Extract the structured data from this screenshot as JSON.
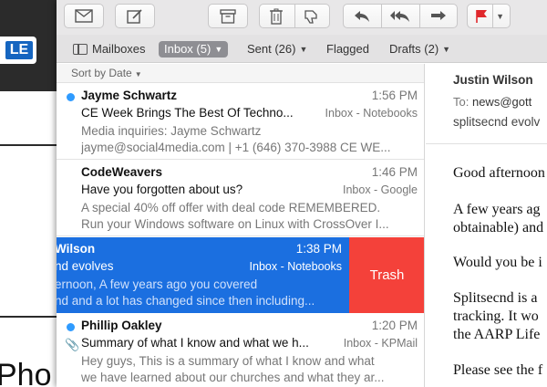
{
  "desktop": {
    "logo_text": "LE",
    "bottom_text": "Pho"
  },
  "toolbar": {
    "buttons": [
      {
        "icon": "envelope-icon"
      },
      {
        "icon": "compose-icon"
      },
      {
        "icon": "archive-icon"
      },
      {
        "icon": "trash-icon"
      },
      {
        "icon": "junk-icon"
      },
      {
        "icon": "reply-icon"
      },
      {
        "icon": "reply-all-icon"
      },
      {
        "icon": "forward-icon"
      },
      {
        "icon": "flag-icon"
      }
    ],
    "flag_color": "#e0282c"
  },
  "favorites": {
    "mailboxes": "Mailboxes",
    "inbox": "Inbox (5)",
    "sent": "Sent (26)",
    "flagged": "Flagged",
    "drafts": "Drafts (2)"
  },
  "list": {
    "sort_label": "Sort by Date",
    "messages": [
      {
        "from": "Jayme Schwartz",
        "time": "1:56 PM",
        "subject": "CE Week Brings The Best Of Techno...",
        "mailbox": "Inbox - Notebooks",
        "preview1": "Media inquiries: Jayme Schwartz",
        "preview2": "jayme@social4media.com | +1 (646) 370-3988 CE WE...",
        "unread": true
      },
      {
        "from": "CodeWeavers",
        "time": "1:46 PM",
        "subject": "Have you forgotten about us?",
        "mailbox": "Inbox - Google",
        "preview1": "A special 40% off offer with deal code REMEMBERED.",
        "preview2": "Run your Windows software on Linux with CrossOver I...",
        "unread": false
      },
      {
        "from": "Wilson",
        "time": "1:38 PM",
        "subject": "nd evolves",
        "mailbox": "Inbox - Notebooks",
        "preview1": "ernoon, A few years ago you covered",
        "preview2": "nd and a lot has changed since then including...",
        "swipe_action": "Trash"
      },
      {
        "from": "Phillip Oakley",
        "time": "1:20 PM",
        "subject": "Summary of what I know and what we h...",
        "mailbox": "Inbox - KPMail",
        "preview1": "Hey guys, This is a summary of what I know and what",
        "preview2": "we have learned about our churches and what they ar...",
        "unread": true,
        "attachment": true
      }
    ]
  },
  "reader": {
    "sender": "Justin Wilson",
    "to_label": "To:",
    "to_value": "news@gott",
    "subject": "splitsecnd evolv",
    "body": [
      "Good afternoon",
      "A few years ag",
      "obtainable) and",
      "Would you be i",
      "Splitsecnd is a",
      "tracking. It wo",
      "the AARP Life",
      "Please see the f"
    ]
  }
}
